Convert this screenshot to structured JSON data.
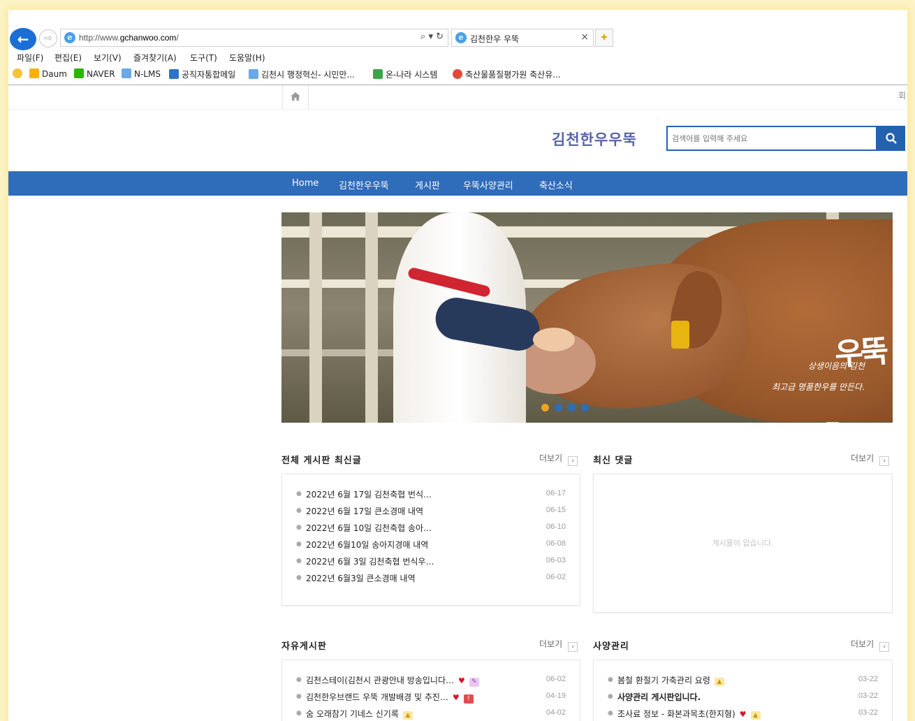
{
  "browser": {
    "url_prefix": "http://www.",
    "url_domain": "gchanwoo.com",
    "url_suffix": "/",
    "tab_title": "김천한우 우뚝",
    "address_tools": "⌕ ▾ ↻",
    "menu": [
      "파일(F)",
      "편집(E)",
      "보기(V)",
      "즐겨찾기(A)",
      "도구(T)",
      "도움말(H)"
    ],
    "favorites": [
      "Daum",
      "NAVER",
      "N-LMS",
      "공직자통합메일",
      "김천시 행정혁신- 시민만...",
      "온-나라 시스템",
      "축산물품질평가원 축산유..."
    ]
  },
  "site": {
    "login_stub": "회",
    "title": "김천한우우뚝",
    "search_placeholder": "검색어를 입력해 주세요",
    "nav": [
      "Home",
      "김천한우우뚝",
      "게시판",
      "우뚝사양관리",
      "축산소식"
    ],
    "banner": {
      "caption_line1": "상생이음의 김천",
      "caption_line2": "최고급 명품한우를 만든다.",
      "brand": "우뚝",
      "slide_count": 4,
      "active_slide": 0
    }
  },
  "boards": {
    "more_label": "더보기",
    "recent_all": {
      "title": "전체 게시판 최신글",
      "posts": [
        {
          "title": "2022년 6월 17일 김천축협 번식…",
          "date": "06-17"
        },
        {
          "title": "2022년 6월 17일 큰소경매 내역",
          "date": "06-15"
        },
        {
          "title": "2022년 6월 10일 김천축협 송아…",
          "date": "06-10"
        },
        {
          "title": "2022년 6월10일 송아지경매 내역",
          "date": "06-08"
        },
        {
          "title": "2022년 6월 3일 김천축협 번식우…",
          "date": "06-03"
        },
        {
          "title": "2022년 6월3일 큰소경매 내역",
          "date": "06-02"
        }
      ]
    },
    "recent_comments": {
      "title": "최신 댓글",
      "empty_text": "게시물이 없습니다."
    },
    "free_board": {
      "title": "자유게시판",
      "posts": [
        {
          "title": "김천스테이(김천시 관광안내 방송입니다…",
          "date": "06-02",
          "heart": true,
          "badge": "file"
        },
        {
          "title": "김천한우브랜드 우뚝 개발배경 및 추진…",
          "date": "04-19",
          "heart": true,
          "badge": "new"
        },
        {
          "title": "숨 오래참기 기네스 신기록",
          "date": "04-02",
          "heart": false,
          "badge": "image"
        }
      ]
    },
    "feeding": {
      "title": "사양관리",
      "posts": [
        {
          "title": "봄철 환절기 가축관리 요령",
          "date": "03-22",
          "heart": false,
          "badge": "image",
          "strong": false
        },
        {
          "title": "사양관리 게시판입니다.",
          "date": "03-22",
          "heart": false,
          "badge": "",
          "strong": true
        },
        {
          "title": "조사료 정보 - 화본과목초(한지형)",
          "date": "03-22",
          "heart": true,
          "badge": "image",
          "strong": false
        }
      ]
    }
  },
  "colors": {
    "nav_bg": "#2f6cb9",
    "title": "#5a64a8",
    "heart": "#d11a2a",
    "page_bg": "#fdf3c8"
  }
}
